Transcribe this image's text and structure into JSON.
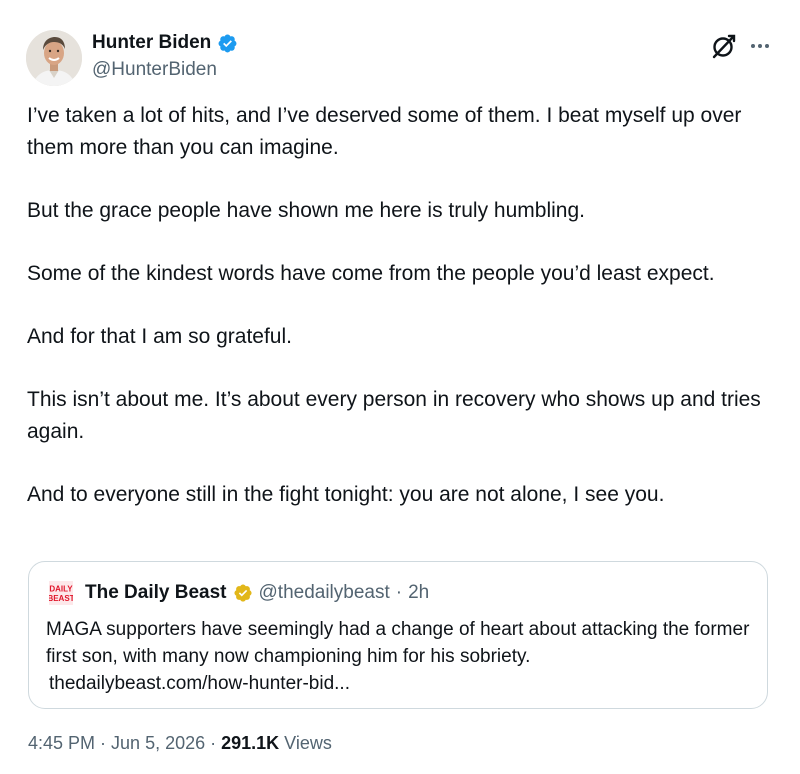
{
  "author": {
    "display_name": "Hunter Biden",
    "handle": "@HunterBiden",
    "verified_badge": "blue-check-icon"
  },
  "toolbar": {
    "grok_icon": "grok-icon",
    "more_icon": "more-icon"
  },
  "tweet": {
    "paragraphs": [
      "I’ve taken a lot of hits, and I’ve deserved some of them. I beat myself up over them more than you can imagine.",
      "But the grace people have shown me here is truly humbling.",
      "Some of the kindest words have come from the people you’d least expect.",
      "And for that I am so grateful.",
      "This isn’t about me. It’s about every person in recovery who shows up and tries again.",
      "And to everyone still in the fight tonight: you are not alone, I see you."
    ]
  },
  "quote": {
    "logo_text": "DAILY BEAST",
    "name": "The Daily Beast",
    "badge": "gold-check-icon",
    "handle": "@thedailybeast",
    "separator": "·",
    "time": "2h",
    "text": "MAGA supporters have seemingly had a change of heart about attacking the former first son, with many now championing him for his sobriety.",
    "link": "thedailybeast.com/how-hunter-bid..."
  },
  "meta": {
    "time": "4:45 PM",
    "sep1": " · ",
    "date": "Jun 5, 2026",
    "sep2": " · ",
    "views_count": "291.1K",
    "views_label": " Views"
  },
  "colors": {
    "verified_blue": "#1d9bf0",
    "gold_badge": "#e2b719",
    "daily_beast_red": "#e0162b",
    "secondary_text": "#536471",
    "border": "#cfd9de"
  }
}
